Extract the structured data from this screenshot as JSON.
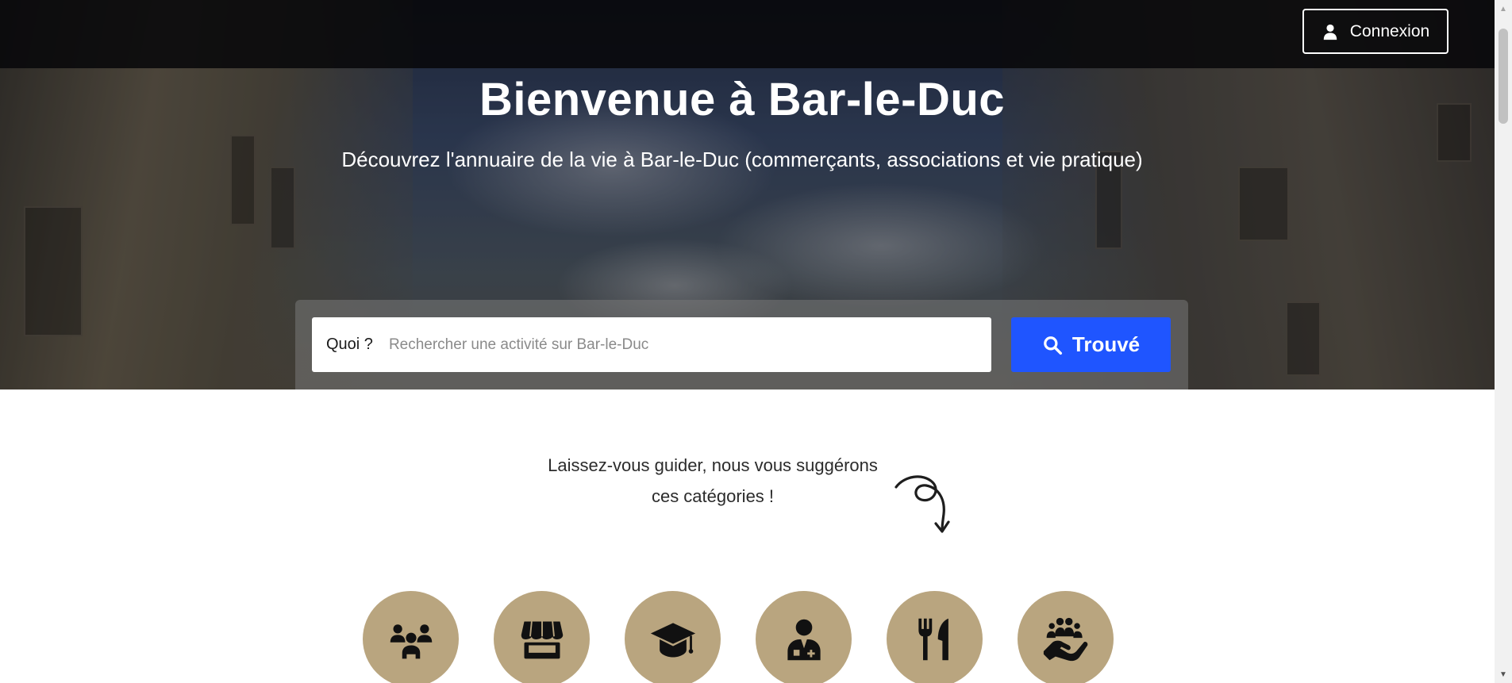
{
  "header": {
    "login_label": "Connexion",
    "login_icon": "user-icon"
  },
  "hero": {
    "title": "Bienvenue à Bar-le-Duc",
    "subtitle": "Découvrez l'annuaire de la vie à Bar-le-Duc (commerçants, associations et vie pratique)"
  },
  "search": {
    "label": "Quoi ?",
    "placeholder": "Rechercher une activité sur Bar-le-Duc",
    "value": "",
    "button_label": "Trouvé",
    "button_icon": "search-icon"
  },
  "guide": {
    "line1": "Laissez-vous guider, nous vous suggérons",
    "line2": "ces catégories !",
    "decoration": "curly-arrow-icon"
  },
  "categories": [
    {
      "icon": "people-group-icon"
    },
    {
      "icon": "shop-icon"
    },
    {
      "icon": "graduation-cap-icon"
    },
    {
      "icon": "doctor-icon"
    },
    {
      "icon": "utensils-icon"
    },
    {
      "icon": "hand-holding-people-icon"
    }
  ],
  "colors": {
    "topbar": "#0a0a0a",
    "search_button": "#1f55ff",
    "category_circle": "#b9a57f",
    "icon": "#111111"
  }
}
